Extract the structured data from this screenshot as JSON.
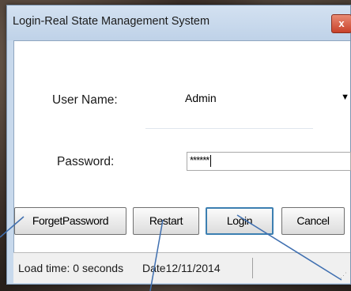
{
  "window": {
    "title": "Login-Real State Management System",
    "close_glyph": "x"
  },
  "form": {
    "username_label": "User Name:",
    "username_value": "Admin",
    "password_label": "Password:",
    "password_value": "******"
  },
  "buttons": {
    "forget_password": "ForgetPassword",
    "restart": "Restart",
    "login": "Login",
    "cancel": "Cancel"
  },
  "status": {
    "load_time": "Load time: 0 seconds",
    "date": "Date12/11/2014"
  },
  "colors": {
    "window_frame": "#c8d9ec",
    "annotation_line": "#3f6fb0"
  }
}
